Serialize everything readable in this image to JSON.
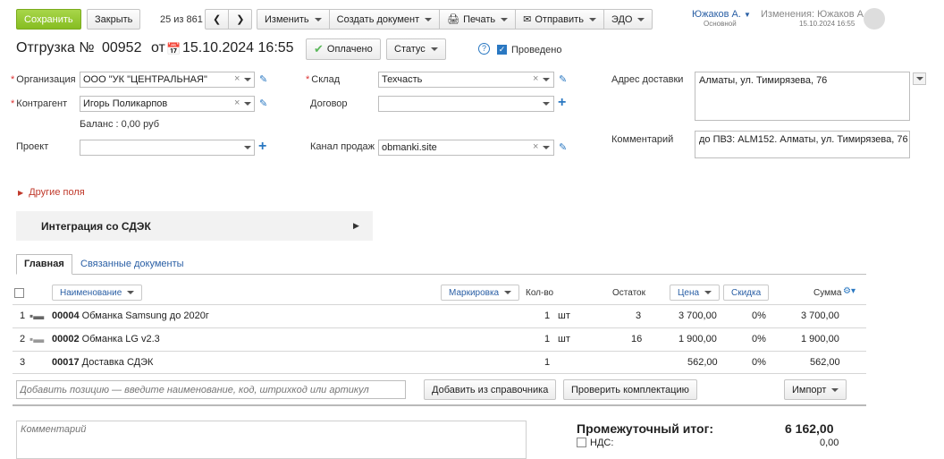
{
  "toolbar": {
    "save": "Сохранить",
    "close": "Закрыть",
    "pager": "25 из 861",
    "menu": [
      "Изменить",
      "Создать документ",
      "Печать",
      "Отправить",
      "ЭДО"
    ]
  },
  "user": {
    "name": "Южаков А.",
    "role": "Основной"
  },
  "changes": {
    "label": "Изменения: Южаков А.",
    "date": "15.10.2024 16:55"
  },
  "doc": {
    "title": "Отгрузка №",
    "number": "00952",
    "from": "от",
    "date": "15.10.2024 16:55",
    "paid": "Оплачено",
    "status": "Статус",
    "conducted": "Проведено",
    "help": "?"
  },
  "form": {
    "org_label": "Организация",
    "org_value": "ООО \"УК \"ЦЕНТРАЛЬНАЯ\"",
    "counter_label": "Контрагент",
    "counter_value": "Игорь Поликарпов",
    "balance": "Баланс : 0,00 руб",
    "project_label": "Проект",
    "project_value": "",
    "warehouse_label": "Склад",
    "warehouse_value": "Техчасть",
    "contract_label": "Договор",
    "contract_value": "",
    "channel_label": "Канал продаж",
    "channel_value": "obmanki.site",
    "address_label": "Адрес доставки",
    "address_value": "Алматы, ул. Тимирязева, 76",
    "comment_label": "Комментарий",
    "comment_value": "до ПВЗ: ALM152. Алматы, ул. Тимирязева, 76",
    "other_fields": "Другие поля",
    "cdek": "Интеграция со СДЭК"
  },
  "tabs": [
    "Главная",
    "Связанные документы"
  ],
  "table": {
    "headers": {
      "name": "Наименование",
      "marking": "Маркировка",
      "qty": "Кол-во",
      "stock": "Остаток",
      "price": "Цена",
      "discount": "Скидка",
      "sum": "Сумма"
    },
    "rows": [
      {
        "n": "1",
        "code": "00004",
        "name": "Обманка Samsung до 2020г",
        "qty": "1",
        "unit": "шт",
        "stock": "3",
        "price": "3 700,00",
        "disc": "0%",
        "sum": "3 700,00"
      },
      {
        "n": "2",
        "code": "00002",
        "name": "Обманка LG v2.3",
        "qty": "1",
        "unit": "шт",
        "stock": "16",
        "price": "1 900,00",
        "disc": "0%",
        "sum": "1 900,00"
      },
      {
        "n": "3",
        "code": "00017",
        "name": "Доставка СДЭК",
        "qty": "1",
        "unit": "",
        "stock": "",
        "price": "562,00",
        "disc": "0%",
        "sum": "562,00"
      }
    ],
    "add_placeholder": "Добавить позицию — введите наименование, код, штрихкод или артикул",
    "add_from_ref": "Добавить из справочника",
    "check_kit": "Проверить комплектацию",
    "import": "Импорт"
  },
  "footer": {
    "comment_placeholder": "Комментарий",
    "subtotal_label": "Промежуточный итог:",
    "subtotal_value": "6 162,00",
    "vat_label": "НДС:",
    "vat_value": "0,00"
  },
  "colors": {
    "accent": "#2a78c2",
    "save": "#8cc22a",
    "required": "#d33"
  }
}
